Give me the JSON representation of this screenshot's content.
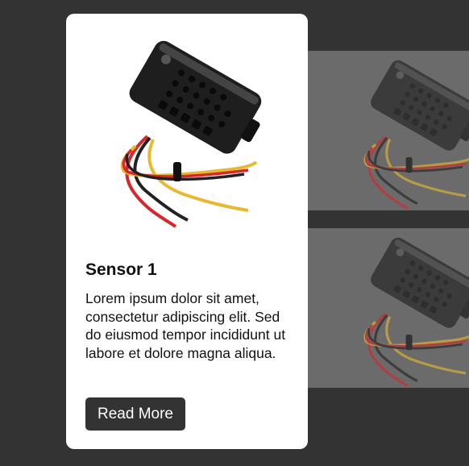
{
  "card": {
    "title": "Sensor 1",
    "description": "Lorem ipsum dolor sit amet, consectetur adipiscing elit. Sed do eiusmod tempor incididunt ut labore et dolore magna aliqua.",
    "button_label": "Read More",
    "image": "sensor-image"
  },
  "thumbnails": [
    {
      "image": "sensor-image"
    },
    {
      "image": "sensor-image"
    }
  ],
  "colors": {
    "background": "#333333",
    "card": "#ffffff",
    "button": "#333333",
    "thumbnail_overlay": "#6b6b6b"
  }
}
